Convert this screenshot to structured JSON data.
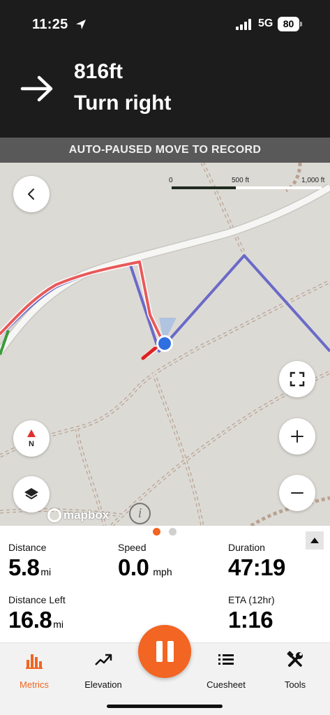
{
  "status_bar": {
    "time": "11:25",
    "network": "5G",
    "battery": "80"
  },
  "navigation": {
    "distance": "816ft",
    "instruction": "Turn right",
    "direction_icon": "arrow-right-icon"
  },
  "banner": {
    "text": "AUTO-PAUSED MOVE TO RECORD"
  },
  "map": {
    "scale_labels": [
      "0",
      "500 ft",
      "1,000 ft"
    ],
    "attribution": "mapbox",
    "compass_label": "N",
    "buttons": [
      "back-icon",
      "compass-icon",
      "layers-icon",
      "fullscreen-icon",
      "zoom-in-icon",
      "zoom-out-icon"
    ],
    "colors": {
      "route": "#6b6bc4",
      "track": "#e85a5a",
      "road": "#f4f4f2",
      "trail": "#b8a08f",
      "location": "#2f6fe0"
    }
  },
  "pager": {
    "pages": 2,
    "active": 0
  },
  "metrics": {
    "distance": {
      "label": "Distance",
      "value": "5.8",
      "unit": "mi"
    },
    "speed": {
      "label": "Speed",
      "value": "0.0",
      "unit": "mph"
    },
    "duration": {
      "label": "Duration",
      "value": "47:19"
    },
    "distance_left": {
      "label": "Distance Left",
      "value": "16.8",
      "unit": "mi"
    },
    "eta": {
      "label": "ETA (12hr)",
      "value": "1:16"
    }
  },
  "tabs": [
    {
      "label": "Metrics",
      "icon": "bar-chart-icon",
      "active": true
    },
    {
      "label": "Elevation",
      "icon": "trend-up-icon",
      "active": false
    },
    {
      "label": "Cuesheet",
      "icon": "list-icon",
      "active": false
    },
    {
      "label": "Tools",
      "icon": "tools-icon",
      "active": false
    }
  ],
  "colors": {
    "accent": "#f26522",
    "topbar": "#1c1c1c",
    "banner": "#595959"
  }
}
